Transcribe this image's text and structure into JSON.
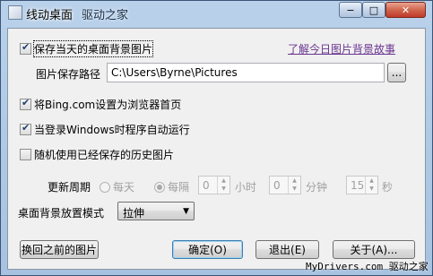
{
  "window": {
    "title": "线动桌面",
    "title_watermark": "驱动之家",
    "controls": {
      "minimize": "−",
      "maximize": "□",
      "close": "✕"
    }
  },
  "options": {
    "save_bg": {
      "label": "保存当天的桌面背景图片",
      "checked": true
    },
    "story_link": "了解今日图片背景故事",
    "save_path": {
      "label": "图片保存路径",
      "value": "C:\\Users\\Byrne\\Pictures",
      "browse": "..."
    },
    "bing_home": {
      "label": "将Bing.com设置为浏览器首页",
      "checked": true
    },
    "autorun": {
      "label": "当登录Windows时程序自动运行",
      "checked": true
    },
    "random_history": {
      "label": "随机使用已经保存的历史图片",
      "checked": false
    }
  },
  "update": {
    "label": "更新周期",
    "daily": "每天",
    "every": "每隔",
    "hours": {
      "value": "0",
      "unit": "小时"
    },
    "minutes": {
      "value": "0",
      "unit": "分钟"
    },
    "seconds": {
      "value": "15",
      "unit": "秒"
    }
  },
  "placement": {
    "label": "桌面背景放置模式",
    "selected": "拉伸"
  },
  "buttons": {
    "restore": "换回之前的图片",
    "ok": "确定(O)",
    "exit": "退出(E)",
    "about": "关于(A)..."
  },
  "footer_watermark": "MyDrivers.com 驱动之家"
}
